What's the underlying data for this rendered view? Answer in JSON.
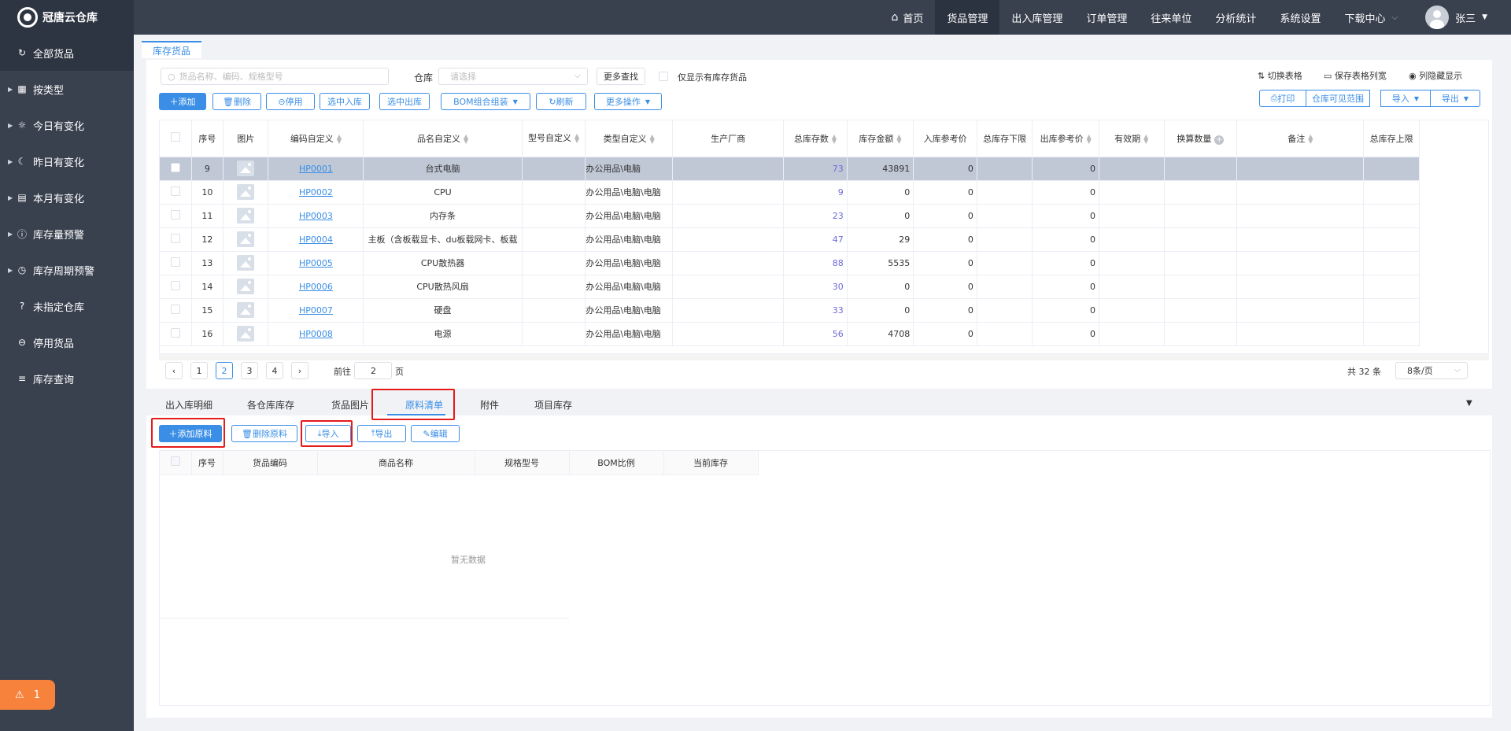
{
  "app": {
    "title": "冠唐云仓库"
  },
  "topnav": {
    "items": [
      {
        "label": "首页",
        "icon": "home-icon"
      },
      {
        "label": "货品管理",
        "active": true
      },
      {
        "label": "出入库管理"
      },
      {
        "label": "订单管理"
      },
      {
        "label": "往来单位"
      },
      {
        "label": "分析统计"
      },
      {
        "label": "系统设置"
      },
      {
        "label": "下载中心"
      }
    ],
    "user": "张三"
  },
  "sidebar": {
    "items": [
      {
        "label": "全部货品",
        "icon": "refresh-icon",
        "active": true
      },
      {
        "label": "按类型",
        "icon": "grid-icon"
      },
      {
        "label": "今日有变化",
        "icon": "sun-icon"
      },
      {
        "label": "昨日有变化",
        "icon": "moon-icon"
      },
      {
        "label": "本月有变化",
        "icon": "calendar-icon"
      },
      {
        "label": "库存量预警",
        "icon": "alert-icon"
      },
      {
        "label": "库存周期预警",
        "icon": "clock-icon"
      },
      {
        "label": "未指定仓库",
        "icon": "question-icon"
      },
      {
        "label": "停用货品",
        "icon": "minus-circle-icon"
      },
      {
        "label": "库存查询",
        "icon": "list-icon"
      }
    ],
    "alarm_count": "1"
  },
  "tab": {
    "label": "库存货品"
  },
  "toolbar": {
    "search_placeholder": "货品名称、编码、规格型号",
    "warehouse_label": "仓库",
    "warehouse_placeholder": "请选择",
    "more_search": "更多查找",
    "only_stock": "仅显示有库存货品",
    "switch_table": "切换表格",
    "save_width": "保存表格列宽",
    "hide_columns": "列隐藏显示",
    "add": "添加",
    "delete": "删除",
    "disable": "停用",
    "stock_in": "选中入库",
    "stock_out": "选中出库",
    "bom": "BOM组合组装",
    "refresh": "刷新",
    "more_ops": "更多操作",
    "print": "打印",
    "scope": "仓库可见范围",
    "import": "导入",
    "export": "导出"
  },
  "table": {
    "headers": [
      "序号",
      "图片",
      "编码自定义",
      "品名自定义",
      "型号自定义",
      "类型自定义",
      "生产厂商",
      "总库存数",
      "库存金额",
      "入库参考价",
      "总库存下限",
      "出库参考价",
      "有效期",
      "换算数量",
      "备注",
      "总库存上限"
    ],
    "rows": [
      {
        "no": "9",
        "code": "HP0001",
        "name": "台式电脑",
        "type": "办公用品\\电脑",
        "stock": "73",
        "amount": "43891",
        "in_price": "0",
        "out_price": "0"
      },
      {
        "no": "10",
        "code": "HP0002",
        "name": "CPU",
        "type": "办公用品\\电脑\\电脑",
        "stock": "9",
        "amount": "0",
        "in_price": "0",
        "out_price": "0"
      },
      {
        "no": "11",
        "code": "HP0003",
        "name": "内存条",
        "type": "办公用品\\电脑\\电脑",
        "stock": "23",
        "amount": "0",
        "in_price": "0",
        "out_price": "0"
      },
      {
        "no": "12",
        "code": "HP0004",
        "name": "主板（含板载显卡、du板载网卡、板载",
        "type": "办公用品\\电脑\\电脑",
        "stock": "47",
        "amount": "29",
        "in_price": "0",
        "out_price": "0"
      },
      {
        "no": "13",
        "code": "HP0005",
        "name": "CPU散热器",
        "type": "办公用品\\电脑\\电脑",
        "stock": "88",
        "amount": "5535",
        "in_price": "0",
        "out_price": "0"
      },
      {
        "no": "14",
        "code": "HP0006",
        "name": "CPU散热风扇",
        "type": "办公用品\\电脑\\电脑",
        "stock": "30",
        "amount": "0",
        "in_price": "0",
        "out_price": "0"
      },
      {
        "no": "15",
        "code": "HP0007",
        "name": "硬盘",
        "type": "办公用品\\电脑\\电脑",
        "stock": "33",
        "amount": "0",
        "in_price": "0",
        "out_price": "0"
      },
      {
        "no": "16",
        "code": "HP0008",
        "name": "电源",
        "type": "办公用品\\电脑\\电脑",
        "stock": "56",
        "amount": "4708",
        "in_price": "0",
        "out_price": "0"
      }
    ]
  },
  "pagination": {
    "pages": [
      "1",
      "2",
      "3",
      "4"
    ],
    "current": "2",
    "goto_prefix": "前往",
    "goto_value": "2",
    "goto_suffix": "页",
    "total": "共 32 条",
    "page_size": "8条/页"
  },
  "subtabs": {
    "items": [
      "出入库明细",
      "各仓库库存",
      "货品图片",
      "原料清单",
      "附件",
      "项目库存"
    ],
    "active": "原料清单"
  },
  "bom_toolbar": {
    "add": "添加原料",
    "delete": "删除原料",
    "import": "导入",
    "export": "导出",
    "edit": "编辑"
  },
  "bom_table": {
    "headers": [
      "序号",
      "货品编码",
      "商品名称",
      "规格型号",
      "BOM比例",
      "当前库存"
    ],
    "empty": "暂无数据"
  }
}
